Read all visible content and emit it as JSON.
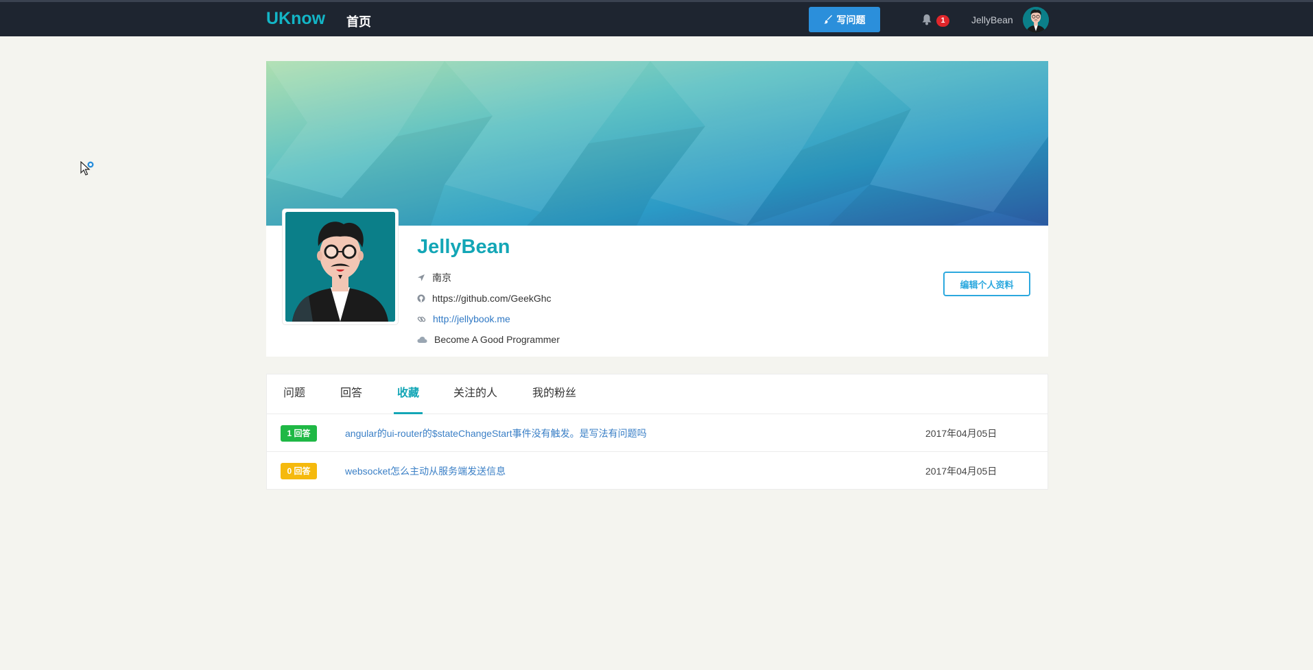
{
  "nav": {
    "brand": "UKnow",
    "home": "首页",
    "ask_button": "写问题",
    "notification_count": "1",
    "username": "JellyBean"
  },
  "profile": {
    "name": "JellyBean",
    "location": "南京",
    "github": "https://github.com/GeekGhc",
    "website": "http://jellybook.me",
    "motto": "Become A Good Programmer",
    "edit_button": "编辑个人资料"
  },
  "tabs": [
    {
      "label": "问题",
      "active": false
    },
    {
      "label": "回答",
      "active": false
    },
    {
      "label": "收藏",
      "active": true
    },
    {
      "label": "关注的人",
      "active": false
    },
    {
      "label": "我的粉丝",
      "active": false
    }
  ],
  "favorites": [
    {
      "badge": "1 回答",
      "badge_color": "#1fb845",
      "title": "angular的ui-router的$stateChangeStart事件没有触发。是写法有问题吗",
      "date": "2017年04月05日"
    },
    {
      "badge": "0 回答",
      "badge_color": "#f5b90d",
      "title": "websocket怎么主动从服务端发送信息",
      "date": "2017年04月05日"
    }
  ],
  "icons": {
    "location": "location-arrow-icon",
    "github": "github-icon",
    "website": "link-icon",
    "motto": "cloud-icon",
    "bell": "bell-icon",
    "ask": "brush-icon"
  },
  "colors": {
    "accent": "#13a6b6",
    "navbar": "#1e2530",
    "primary_button": "#2b8fdb"
  }
}
